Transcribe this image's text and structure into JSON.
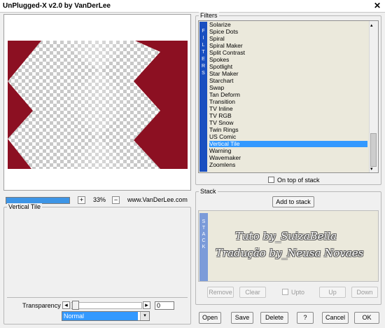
{
  "window": {
    "title": "UnPlugged-X v2.0 by VanDerLee",
    "close_glyph": "✕"
  },
  "preview": {
    "zoom_percent": "33%",
    "progress_fraction": 1.0,
    "website": "www.VanDerLee.com",
    "plus_glyph": "+",
    "minus_glyph": "−",
    "colors": {
      "background": "#8c1022",
      "checker": "#c8c8c8"
    }
  },
  "filter_panel": {
    "label": "Vertical Tile",
    "transparency_label": "Transparency",
    "transparency_value": "0",
    "blend_mode": "Normal",
    "left_arrow": "◂",
    "right_arrow": "▸",
    "dropdown_arrow": "▾"
  },
  "filters": {
    "label": "Filters",
    "strip_letters": [
      "F",
      "I",
      "L",
      "T",
      "E",
      "R",
      "S"
    ],
    "items": [
      "Solarize",
      "Spice Dots",
      "Spiral",
      "Spiral Maker",
      "Split Contrast",
      "Spokes",
      "Spotlight",
      "Star Maker",
      "Starchart",
      "Swap",
      "Tan Deform",
      "Transition",
      "TV Inline",
      "TV RGB",
      "TV Snow",
      "Twin Rings",
      "US Comic",
      "Vertical Tile",
      "Warning",
      "Wavemaker",
      "Zoomlens"
    ],
    "selected": "Vertical Tile",
    "on_top_of_stack_label": "On top of stack",
    "scroll_up": "▴",
    "scroll_down": "▾"
  },
  "stack": {
    "label": "Stack",
    "add_button": "Add to stack",
    "strip_letters": [
      "S",
      "T",
      "A",
      "C",
      "K"
    ],
    "watermark_line1": "Tuto by_SuizaBella",
    "watermark_line2": "Tradução by_Neusa Novaes",
    "remove_button": "Remove",
    "clear_button": "Clear",
    "upto_label": "Upto",
    "up_button": "Up",
    "down_button": "Down"
  },
  "footer": {
    "open": "Open",
    "save": "Save",
    "delete": "Delete",
    "help": "?",
    "cancel": "Cancel",
    "ok": "OK"
  }
}
